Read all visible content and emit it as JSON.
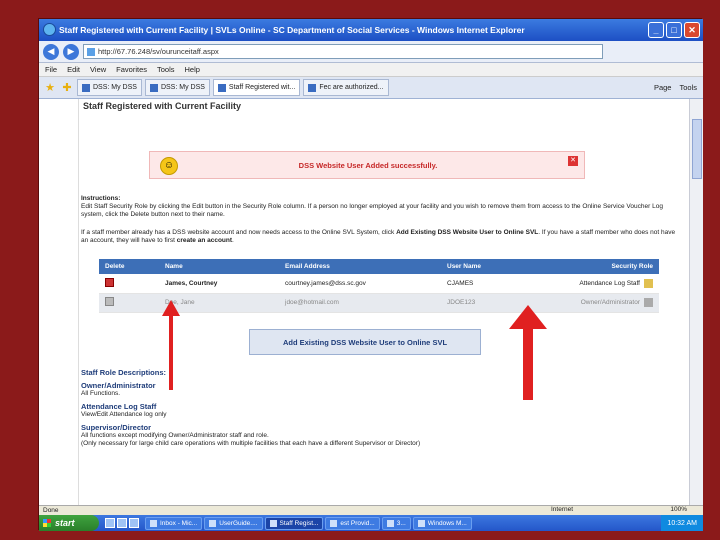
{
  "window": {
    "title": "Staff Registered with Current Facility | SVLs Online - SC Department of Social Services - Windows Internet Explorer",
    "url": "http://67.76.248/sv/ourunceitaff.aspx"
  },
  "menu": [
    "File",
    "Edit",
    "View",
    "Favorites",
    "Tools",
    "Help"
  ],
  "tabs": [
    {
      "label": "DSS: My DSS"
    },
    {
      "label": "DSS: My DSS"
    },
    {
      "label": "Staff Registered wit..."
    },
    {
      "label": "Fec are authorized..."
    }
  ],
  "tab_tools": [
    "Page",
    "Tools"
  ],
  "page": {
    "heading": "Staff Registered with Current Facility",
    "success_message": "DSS Website User Added successfully.",
    "instructions_title": "Instructions:",
    "instructions_line1": "Edit Staff Security Role by clicking the Edit button in the Security Role column. If a person no longer employed at your facility and you wish to remove them from access to the Online Service Voucher Log system, click the Delete button next to their name.",
    "instructions_line2a": "If a staff member already has a DSS website account and now needs access to the Online SVL System, click",
    "instructions_link1": "Add Existing DSS Website User to Online SVL",
    "instructions_line2b": ". If you have a staff member who does not have an account, they will have to first",
    "instructions_link2": "create an account"
  },
  "table": {
    "headers": [
      "Delete",
      "Name",
      "Email Address",
      "User Name",
      "Security Role"
    ],
    "rows": [
      {
        "name": "James, Courtney",
        "email": "courtney.james@dss.sc.gov",
        "username": "CJAMES",
        "role": "Attendance Log Staff"
      },
      {
        "name": "Doe, Jane",
        "email": "jdoe@hotmail.com",
        "username": "JDOE123",
        "role": "Owner/Administrator"
      }
    ]
  },
  "add_existing_button": "Add Existing DSS Website User to Online SVL",
  "roles": {
    "section_title": "Staff Role Descriptions:",
    "owner_title": "Owner/Administrator",
    "owner_desc": "All Functions.",
    "attendance_title": "Attendance Log Staff",
    "attendance_desc": "View/Edit Attendance log only",
    "supervisor_title": "Supervisor/Director",
    "supervisor_desc1": "All functions except modifying Owner/Administrator staff and role.",
    "supervisor_desc2": "(Only necessary for large child care operations with multiple facilities that each have a different Supervisor or Director)"
  },
  "status": {
    "left": "Done",
    "zone": "Internet",
    "zoom": "100%"
  },
  "taskbar": {
    "start": "start",
    "items": [
      {
        "label": "Inbox - Mic..."
      },
      {
        "label": "UserGuide...."
      },
      {
        "label": "Staff Regist..."
      },
      {
        "label": "est Provid..."
      },
      {
        "label": "3..."
      },
      {
        "label": "Windows M..."
      }
    ],
    "clock": "10:32 AM"
  }
}
